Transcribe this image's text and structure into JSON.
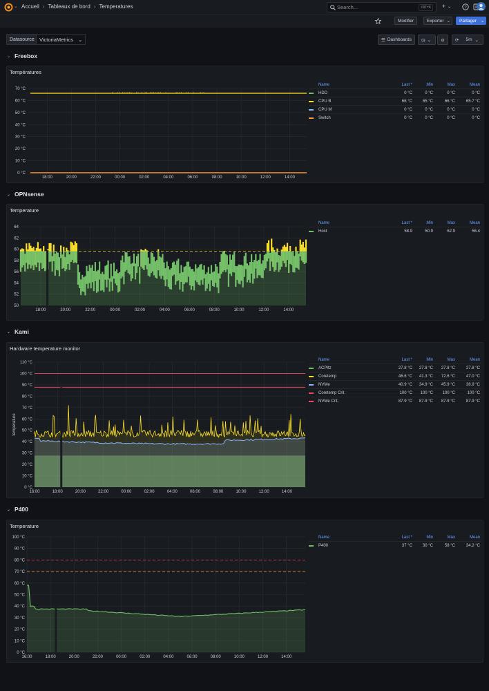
{
  "header": {
    "breadcrumbs": [
      "Accueil",
      "Tableaux de bord",
      "Temperatures"
    ],
    "search_placeholder": "Search...",
    "search_shortcut": "ctrl+k",
    "plus_label": "+",
    "help_label": "?",
    "modifier_label": "Modifier",
    "exporter_label": "Exporter",
    "partager_label": "Partager"
  },
  "controls": {
    "datasource_label": "Datasource",
    "datasource_value": "VictoriaMetrics",
    "dashboards_label": "Dashboards",
    "refresh_label": "5m"
  },
  "colors": {
    "green": "#73bf69",
    "yellow": "#fade2a",
    "blue": "#8ab8ff",
    "orange": "#ff9830",
    "red": "#f2495c",
    "legend_header": "#6e9fff"
  },
  "rows": [
    {
      "title": "Freebox",
      "panel_title": "Températures",
      "legend_headers": [
        "Name",
        "Last *",
        "Min",
        "Max",
        "Mean"
      ],
      "legend": [
        {
          "name": "HDD",
          "color": "#73bf69",
          "last": "0 °C",
          "min": "0 °C",
          "max": "0 °C",
          "mean": "0 °C"
        },
        {
          "name": "CPU B",
          "color": "#fade2a",
          "last": "66 °C",
          "min": "65 °C",
          "max": "66 °C",
          "mean": "65.7 °C"
        },
        {
          "name": "CPU M",
          "color": "#8ab8ff",
          "last": "0 °C",
          "min": "0 °C",
          "max": "0 °C",
          "mean": "0 °C"
        },
        {
          "name": "Switch",
          "color": "#ff9830",
          "last": "0 °C",
          "min": "0 °C",
          "max": "0 °C",
          "mean": "0 °C"
        }
      ],
      "y_ticks": [
        "70 °C",
        "60 °C",
        "50 °C",
        "40 °C",
        "30 °C",
        "20 °C",
        "10 °C",
        "0 °C"
      ],
      "x_ticks": [
        "18:00",
        "20:00",
        "22:00",
        "00:00",
        "02:00",
        "04:00",
        "06:00",
        "08:00",
        "10:00",
        "12:00",
        "14:00"
      ]
    },
    {
      "title": "OPNsense",
      "panel_title": "Temperature",
      "legend_headers": [
        "Name",
        "Last *",
        "Min",
        "Max",
        "Mean"
      ],
      "legend": [
        {
          "name": "Host",
          "color": "#73bf69",
          "last": "58.9",
          "min": "50.9",
          "max": "62.9",
          "mean": "56.4"
        }
      ],
      "y_ticks": [
        "64",
        "62",
        "60",
        "58",
        "56",
        "54",
        "52",
        "50"
      ],
      "x_ticks": [
        "18:00",
        "20:00",
        "22:00",
        "00:00",
        "02:00",
        "04:00",
        "06:00",
        "08:00",
        "10:00",
        "12:00",
        "14:00"
      ]
    },
    {
      "title": "Kami",
      "panel_title": "Hardware temperature monitor",
      "y_axis_label": "temperature",
      "legend_headers": [
        "Name",
        "Last *",
        "Min",
        "Max",
        "Mean"
      ],
      "legend": [
        {
          "name": "ACPItz",
          "color": "#73bf69",
          "last": "27.8 °C",
          "min": "27.8 °C",
          "max": "27.8 °C",
          "mean": "27.8 °C"
        },
        {
          "name": "Coretemp",
          "color": "#fade2a",
          "last": "46.6 °C",
          "min": "41.3 °C",
          "max": "72.6 °C",
          "mean": "47.0 °C"
        },
        {
          "name": "NVMe",
          "color": "#8ab8ff",
          "last": "40.9 °C",
          "min": "34.9 °C",
          "max": "45.9 °C",
          "mean": "38.9 °C"
        },
        {
          "name": "Coretemp Crit.",
          "color": "#f2495c",
          "last": "100 °C",
          "min": "100 °C",
          "max": "100 °C",
          "mean": "100 °C"
        },
        {
          "name": "NVMe Crit.",
          "color": "#f2495c",
          "last": "87.9 °C",
          "min": "87.9 °C",
          "max": "87.9 °C",
          "mean": "87.9 °C"
        }
      ],
      "y_ticks": [
        "110 °C",
        "100 °C",
        "90 °C",
        "80 °C",
        "70 °C",
        "60 °C",
        "50 °C",
        "40 °C",
        "30 °C",
        "20 °C",
        "10 °C",
        "0 °C"
      ],
      "x_ticks": [
        "16:00",
        "18:00",
        "20:00",
        "22:00",
        "00:00",
        "02:00",
        "04:00",
        "06:00",
        "08:00",
        "10:00",
        "12:00",
        "14:00"
      ]
    },
    {
      "title": "P400",
      "panel_title": "Temperature",
      "legend_headers": [
        "Name",
        "Last *",
        "Min",
        "Max",
        "Mean"
      ],
      "legend": [
        {
          "name": "P400",
          "color": "#73bf69",
          "last": "37 °C",
          "min": "30 °C",
          "max": "58 °C",
          "mean": "34.2 °C"
        }
      ],
      "y_ticks": [
        "100 °C",
        "90 °C",
        "80 °C",
        "70 °C",
        "60 °C",
        "50 °C",
        "40 °C",
        "30 °C",
        "20 °C",
        "10 °C",
        "0 °C"
      ],
      "x_ticks": [
        "16:00",
        "18:00",
        "20:00",
        "22:00",
        "00:00",
        "02:00",
        "04:00",
        "06:00",
        "08:00",
        "10:00",
        "12:00",
        "14:00"
      ]
    }
  ],
  "chart_data": [
    {
      "type": "line",
      "ylim": [
        0,
        70
      ],
      "series": [
        {
          "name": "HDD",
          "values": [
            0,
            0
          ]
        },
        {
          "name": "CPU B",
          "values": [
            66,
            66
          ]
        },
        {
          "name": "CPU M",
          "values": [
            0,
            0
          ]
        },
        {
          "name": "Switch",
          "values": [
            0,
            0
          ]
        }
      ]
    },
    {
      "type": "area",
      "ylim": [
        49,
        65
      ],
      "threshold": 60,
      "series": [
        {
          "name": "Host",
          "min": 50.9,
          "max": 62.9,
          "mean": 56.4,
          "last": 58.9
        }
      ]
    },
    {
      "type": "area",
      "ylim": [
        0,
        110
      ],
      "series": [
        {
          "name": "ACPItz",
          "mean": 27.8
        },
        {
          "name": "Coretemp",
          "mean": 47.0,
          "max": 72.6
        },
        {
          "name": "NVMe",
          "mean": 38.9
        },
        {
          "name": "Coretemp Crit.",
          "mean": 100
        },
        {
          "name": "NVMe Crit.",
          "mean": 87.9
        }
      ]
    },
    {
      "type": "area",
      "ylim": [
        0,
        100
      ],
      "thresholds": [
        80,
        70
      ],
      "series": [
        {
          "name": "P400",
          "min": 30,
          "max": 58,
          "mean": 34.2,
          "last": 37
        }
      ]
    }
  ]
}
